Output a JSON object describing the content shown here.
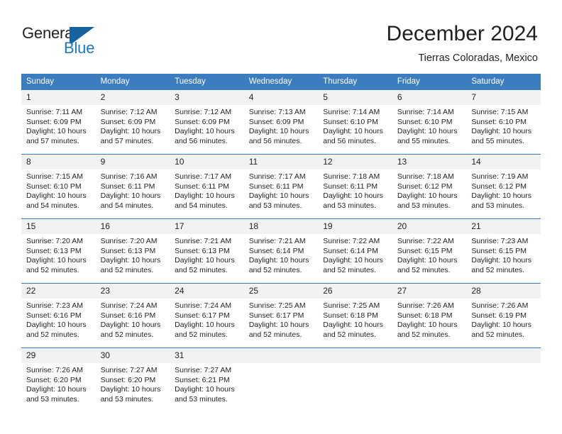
{
  "brand": {
    "name_part1": "General",
    "name_part2": "Blue",
    "flag_icon": "blue-flag-icon",
    "accent_color": "#1c7ac0"
  },
  "header": {
    "title": "December 2024",
    "location": "Tierras Coloradas, Mexico"
  },
  "theme": {
    "header_row_color": "#3c7dc0",
    "daynum_band_color": "#f2f2f2",
    "text_color": "#231f20"
  },
  "weekday_headers": [
    "Sunday",
    "Monday",
    "Tuesday",
    "Wednesday",
    "Thursday",
    "Friday",
    "Saturday"
  ],
  "weeks": [
    [
      {
        "day": "1",
        "sunrise": "Sunrise: 7:11 AM",
        "sunset": "Sunset: 6:09 PM",
        "daylight1": "Daylight: 10 hours",
        "daylight2": "and 57 minutes."
      },
      {
        "day": "2",
        "sunrise": "Sunrise: 7:12 AM",
        "sunset": "Sunset: 6:09 PM",
        "daylight1": "Daylight: 10 hours",
        "daylight2": "and 57 minutes."
      },
      {
        "day": "3",
        "sunrise": "Sunrise: 7:12 AM",
        "sunset": "Sunset: 6:09 PM",
        "daylight1": "Daylight: 10 hours",
        "daylight2": "and 56 minutes."
      },
      {
        "day": "4",
        "sunrise": "Sunrise: 7:13 AM",
        "sunset": "Sunset: 6:09 PM",
        "daylight1": "Daylight: 10 hours",
        "daylight2": "and 56 minutes."
      },
      {
        "day": "5",
        "sunrise": "Sunrise: 7:14 AM",
        "sunset": "Sunset: 6:10 PM",
        "daylight1": "Daylight: 10 hours",
        "daylight2": "and 56 minutes."
      },
      {
        "day": "6",
        "sunrise": "Sunrise: 7:14 AM",
        "sunset": "Sunset: 6:10 PM",
        "daylight1": "Daylight: 10 hours",
        "daylight2": "and 55 minutes."
      },
      {
        "day": "7",
        "sunrise": "Sunrise: 7:15 AM",
        "sunset": "Sunset: 6:10 PM",
        "daylight1": "Daylight: 10 hours",
        "daylight2": "and 55 minutes."
      }
    ],
    [
      {
        "day": "8",
        "sunrise": "Sunrise: 7:15 AM",
        "sunset": "Sunset: 6:10 PM",
        "daylight1": "Daylight: 10 hours",
        "daylight2": "and 54 minutes."
      },
      {
        "day": "9",
        "sunrise": "Sunrise: 7:16 AM",
        "sunset": "Sunset: 6:11 PM",
        "daylight1": "Daylight: 10 hours",
        "daylight2": "and 54 minutes."
      },
      {
        "day": "10",
        "sunrise": "Sunrise: 7:17 AM",
        "sunset": "Sunset: 6:11 PM",
        "daylight1": "Daylight: 10 hours",
        "daylight2": "and 54 minutes."
      },
      {
        "day": "11",
        "sunrise": "Sunrise: 7:17 AM",
        "sunset": "Sunset: 6:11 PM",
        "daylight1": "Daylight: 10 hours",
        "daylight2": "and 53 minutes."
      },
      {
        "day": "12",
        "sunrise": "Sunrise: 7:18 AM",
        "sunset": "Sunset: 6:11 PM",
        "daylight1": "Daylight: 10 hours",
        "daylight2": "and 53 minutes."
      },
      {
        "day": "13",
        "sunrise": "Sunrise: 7:18 AM",
        "sunset": "Sunset: 6:12 PM",
        "daylight1": "Daylight: 10 hours",
        "daylight2": "and 53 minutes."
      },
      {
        "day": "14",
        "sunrise": "Sunrise: 7:19 AM",
        "sunset": "Sunset: 6:12 PM",
        "daylight1": "Daylight: 10 hours",
        "daylight2": "and 53 minutes."
      }
    ],
    [
      {
        "day": "15",
        "sunrise": "Sunrise: 7:20 AM",
        "sunset": "Sunset: 6:13 PM",
        "daylight1": "Daylight: 10 hours",
        "daylight2": "and 52 minutes."
      },
      {
        "day": "16",
        "sunrise": "Sunrise: 7:20 AM",
        "sunset": "Sunset: 6:13 PM",
        "daylight1": "Daylight: 10 hours",
        "daylight2": "and 52 minutes."
      },
      {
        "day": "17",
        "sunrise": "Sunrise: 7:21 AM",
        "sunset": "Sunset: 6:13 PM",
        "daylight1": "Daylight: 10 hours",
        "daylight2": "and 52 minutes."
      },
      {
        "day": "18",
        "sunrise": "Sunrise: 7:21 AM",
        "sunset": "Sunset: 6:14 PM",
        "daylight1": "Daylight: 10 hours",
        "daylight2": "and 52 minutes."
      },
      {
        "day": "19",
        "sunrise": "Sunrise: 7:22 AM",
        "sunset": "Sunset: 6:14 PM",
        "daylight1": "Daylight: 10 hours",
        "daylight2": "and 52 minutes."
      },
      {
        "day": "20",
        "sunrise": "Sunrise: 7:22 AM",
        "sunset": "Sunset: 6:15 PM",
        "daylight1": "Daylight: 10 hours",
        "daylight2": "and 52 minutes."
      },
      {
        "day": "21",
        "sunrise": "Sunrise: 7:23 AM",
        "sunset": "Sunset: 6:15 PM",
        "daylight1": "Daylight: 10 hours",
        "daylight2": "and 52 minutes."
      }
    ],
    [
      {
        "day": "22",
        "sunrise": "Sunrise: 7:23 AM",
        "sunset": "Sunset: 6:16 PM",
        "daylight1": "Daylight: 10 hours",
        "daylight2": "and 52 minutes."
      },
      {
        "day": "23",
        "sunrise": "Sunrise: 7:24 AM",
        "sunset": "Sunset: 6:16 PM",
        "daylight1": "Daylight: 10 hours",
        "daylight2": "and 52 minutes."
      },
      {
        "day": "24",
        "sunrise": "Sunrise: 7:24 AM",
        "sunset": "Sunset: 6:17 PM",
        "daylight1": "Daylight: 10 hours",
        "daylight2": "and 52 minutes."
      },
      {
        "day": "25",
        "sunrise": "Sunrise: 7:25 AM",
        "sunset": "Sunset: 6:17 PM",
        "daylight1": "Daylight: 10 hours",
        "daylight2": "and 52 minutes."
      },
      {
        "day": "26",
        "sunrise": "Sunrise: 7:25 AM",
        "sunset": "Sunset: 6:18 PM",
        "daylight1": "Daylight: 10 hours",
        "daylight2": "and 52 minutes."
      },
      {
        "day": "27",
        "sunrise": "Sunrise: 7:26 AM",
        "sunset": "Sunset: 6:18 PM",
        "daylight1": "Daylight: 10 hours",
        "daylight2": "and 52 minutes."
      },
      {
        "day": "28",
        "sunrise": "Sunrise: 7:26 AM",
        "sunset": "Sunset: 6:19 PM",
        "daylight1": "Daylight: 10 hours",
        "daylight2": "and 52 minutes."
      }
    ],
    [
      {
        "day": "29",
        "sunrise": "Sunrise: 7:26 AM",
        "sunset": "Sunset: 6:20 PM",
        "daylight1": "Daylight: 10 hours",
        "daylight2": "and 53 minutes."
      },
      {
        "day": "30",
        "sunrise": "Sunrise: 7:27 AM",
        "sunset": "Sunset: 6:20 PM",
        "daylight1": "Daylight: 10 hours",
        "daylight2": "and 53 minutes."
      },
      {
        "day": "31",
        "sunrise": "Sunrise: 7:27 AM",
        "sunset": "Sunset: 6:21 PM",
        "daylight1": "Daylight: 10 hours",
        "daylight2": "and 53 minutes."
      },
      {
        "day": "",
        "sunrise": "",
        "sunset": "",
        "daylight1": "",
        "daylight2": ""
      },
      {
        "day": "",
        "sunrise": "",
        "sunset": "",
        "daylight1": "",
        "daylight2": ""
      },
      {
        "day": "",
        "sunrise": "",
        "sunset": "",
        "daylight1": "",
        "daylight2": ""
      },
      {
        "day": "",
        "sunrise": "",
        "sunset": "",
        "daylight1": "",
        "daylight2": ""
      }
    ]
  ]
}
